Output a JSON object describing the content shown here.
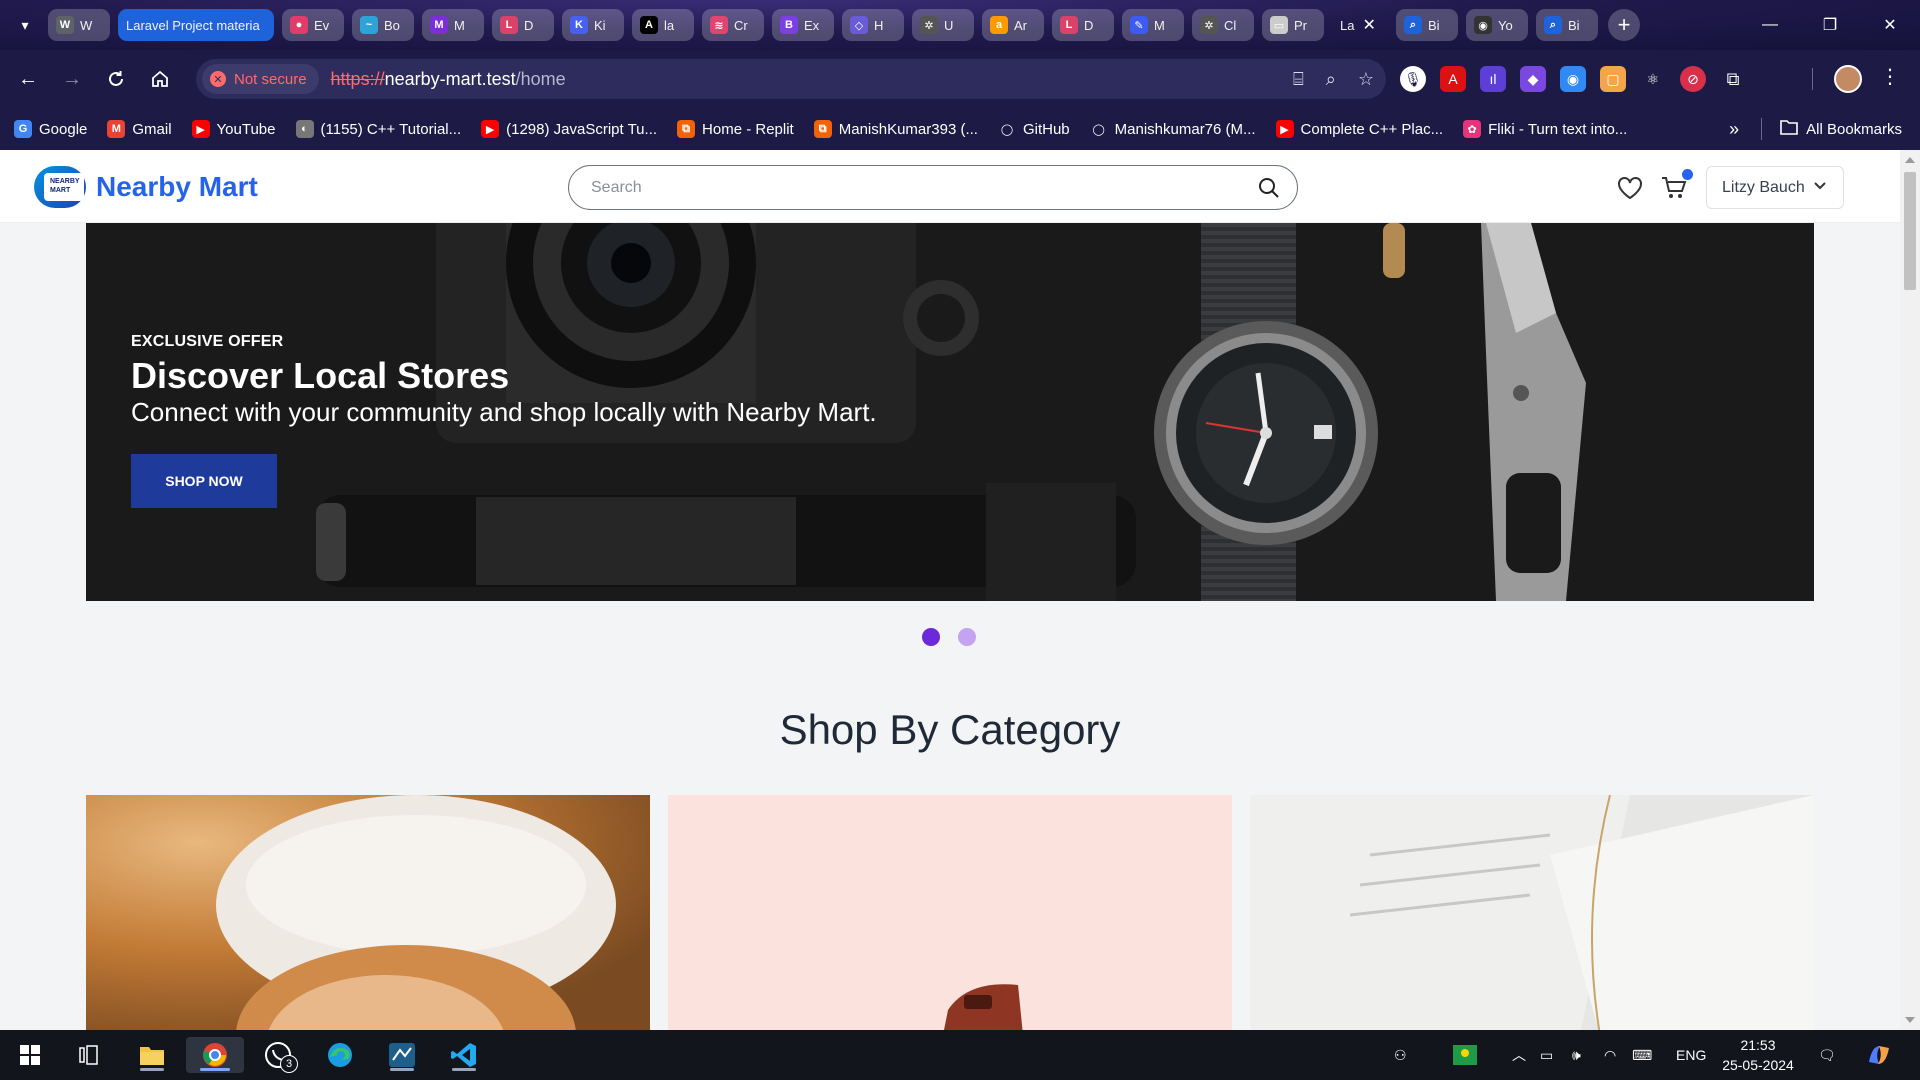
{
  "browser": {
    "tabs": [
      {
        "label": "W",
        "color": "#5f6368",
        "letter": "W"
      },
      {
        "label": "Laravel Project materia",
        "named": true
      },
      {
        "label": "Ev",
        "color": "#e23d6a",
        "letter": "●"
      },
      {
        "label": "Bo",
        "color": "#2da3d8",
        "letter": "~"
      },
      {
        "label": "M",
        "color": "#7b2fd8",
        "letter": "M"
      },
      {
        "label": "D",
        "color": "#d8436a",
        "letter": "L"
      },
      {
        "label": "Ki",
        "color": "#4760f0",
        "letter": "K"
      },
      {
        "label": "la",
        "color": "#000000",
        "letter": "A"
      },
      {
        "label": "Cr",
        "color": "#e0456f",
        "letter": "≋"
      },
      {
        "label": "Ex",
        "color": "#7b3fe4",
        "letter": "B"
      },
      {
        "label": "H",
        "color": "#6a5cd8",
        "letter": "◇"
      },
      {
        "label": "U",
        "color": "#555555",
        "letter": "✲"
      },
      {
        "label": "Ar",
        "color": "#ff9900",
        "letter": "a"
      },
      {
        "label": "D",
        "color": "#d8436a",
        "letter": "L"
      },
      {
        "label": "M",
        "color": "#3d5af1",
        "letter": "✎"
      },
      {
        "label": "Cl",
        "color": "#555555",
        "letter": "✲"
      },
      {
        "label": "Pr",
        "color": "#cccccc",
        "letter": "▭"
      },
      {
        "label": "La",
        "active": true
      },
      {
        "label": "Bi",
        "color": "#1e63d9",
        "letter": "⌕"
      },
      {
        "label": "Yo",
        "color": "#333333",
        "letter": "◉"
      },
      {
        "label": "Bi",
        "color": "#1e63d9",
        "letter": "⌕"
      }
    ],
    "security_label": "Not secure",
    "url_scheme": "https://",
    "url_host": "nearby-mart.test",
    "url_path": "/home",
    "bookmarks": [
      {
        "label": "Google",
        "color": "#4285f4",
        "letter": "G"
      },
      {
        "label": "Gmail",
        "color": "#ea4335",
        "letter": "M"
      },
      {
        "label": "YouTube",
        "color": "#ff0000",
        "letter": "▶"
      },
      {
        "label": "(1155) C++ Tutorial...",
        "color": "#777777",
        "letter": "◐"
      },
      {
        "label": "(1298) JavaScript Tu...",
        "color": "#ff0000",
        "letter": "▶"
      },
      {
        "label": "Home - Replit",
        "color": "#f26207",
        "letter": "⧉"
      },
      {
        "label": "ManishKumar393 (...",
        "color": "#f26207",
        "letter": "⧉"
      },
      {
        "label": "GitHub",
        "color": "#1d1b45",
        "letter": "◯"
      },
      {
        "label": "Manishkumar76 (M...",
        "color": "#1d1b45",
        "letter": "◯"
      },
      {
        "label": "Complete C++ Plac...",
        "color": "#ff0000",
        "letter": "▶"
      },
      {
        "label": "Fliki - Turn text into...",
        "color": "#e5347a",
        "letter": "✿"
      }
    ],
    "all_bookmarks_label": "All Bookmarks"
  },
  "site": {
    "brand": "Nearby Mart",
    "logo_text_line1": "NEARBY",
    "logo_text_line2": "MART",
    "search_placeholder": "Search",
    "user_name": "Litzy Bauch"
  },
  "hero": {
    "eyebrow": "EXCLUSIVE OFFER",
    "title": "Discover Local Stores",
    "subtitle": "Connect with your community and shop locally with Nearby Mart.",
    "cta": "SHOP NOW",
    "slides": 2,
    "active_slide": 1
  },
  "categories_section": {
    "title": "Shop By Category"
  },
  "taskbar": {
    "language": "ENG",
    "time": "21:53",
    "date": "25-05-2024",
    "whatsapp_badge": "3"
  }
}
